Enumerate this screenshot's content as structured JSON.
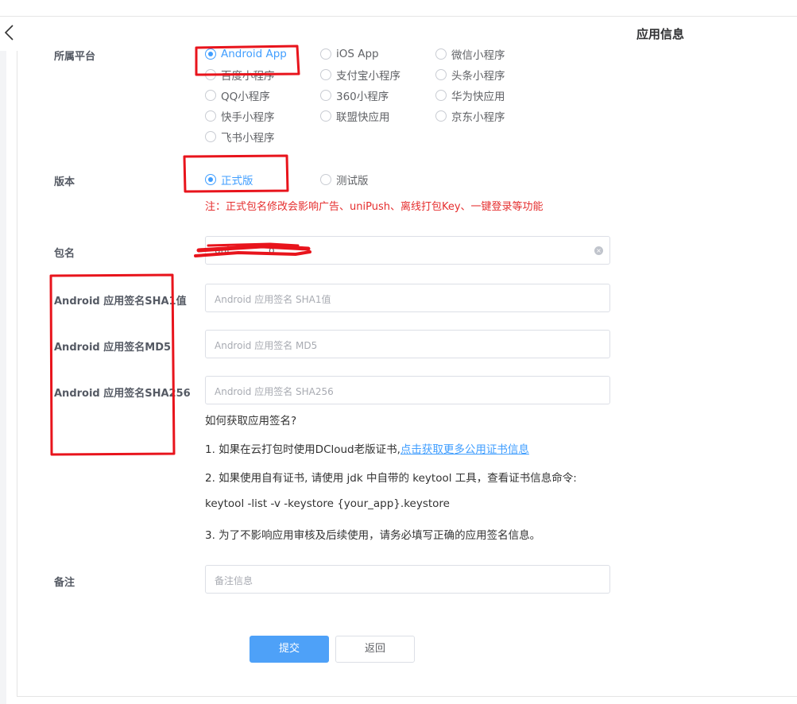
{
  "header": {
    "title": "应用信息"
  },
  "labels": {
    "platform": "所属平台",
    "version": "版本",
    "package": "包名",
    "sha1": "Android 应用签名SHA1值",
    "md5": "Android 应用签名MD5",
    "sha256": "Android 应用签名SHA256",
    "remark": "备注"
  },
  "platforms": [
    {
      "label": "Android App",
      "checked": true
    },
    {
      "label": "iOS App",
      "checked": false
    },
    {
      "label": "微信小程序",
      "checked": false
    },
    {
      "label": "百度小程序",
      "checked": false
    },
    {
      "label": "支付宝小程序",
      "checked": false
    },
    {
      "label": "头条小程序",
      "checked": false
    },
    {
      "label": "QQ小程序",
      "checked": false
    },
    {
      "label": "360小程序",
      "checked": false
    },
    {
      "label": "华为快应用",
      "checked": false
    },
    {
      "label": "快手小程序",
      "checked": false
    },
    {
      "label": "联盟快应用",
      "checked": false
    },
    {
      "label": "京东小程序",
      "checked": false
    },
    {
      "label": "飞书小程序",
      "checked": false
    }
  ],
  "versions": [
    {
      "label": "正式版",
      "checked": true
    },
    {
      "label": "测试版",
      "checked": false
    }
  ],
  "version_note": "注：正式包名修改会影响广告、uniPush、离线打包Key、一键登录等功能",
  "inputs": {
    "package_value": "uni.............o",
    "sha1_placeholder": "Android 应用签名 SHA1值",
    "md5_placeholder": "Android 应用签名  MD5",
    "sha256_placeholder": "Android 应用签名 SHA256",
    "remark_placeholder": "备注信息"
  },
  "help": {
    "title": "如何获取应用签名?",
    "step1_prefix": "1. 如果在云打包时使用DCloud老版证书,",
    "step1_link": "点击获取更多公用证书信息",
    "step2": "2. 如果使用自有证书, 请使用 jdk 中自带的 keytool 工具，查看证书信息命令:",
    "command": "keytool -list -v -keystore {your_app}.keystore",
    "step3": "3. 为了不影响应用审核及后续使用，请务必填写正确的应用签名信息。"
  },
  "buttons": {
    "submit": "提交",
    "back": "返回"
  },
  "colors": {
    "accent": "#409eff",
    "annotation": "#e8141c",
    "warning_text": "#e52e2e"
  }
}
